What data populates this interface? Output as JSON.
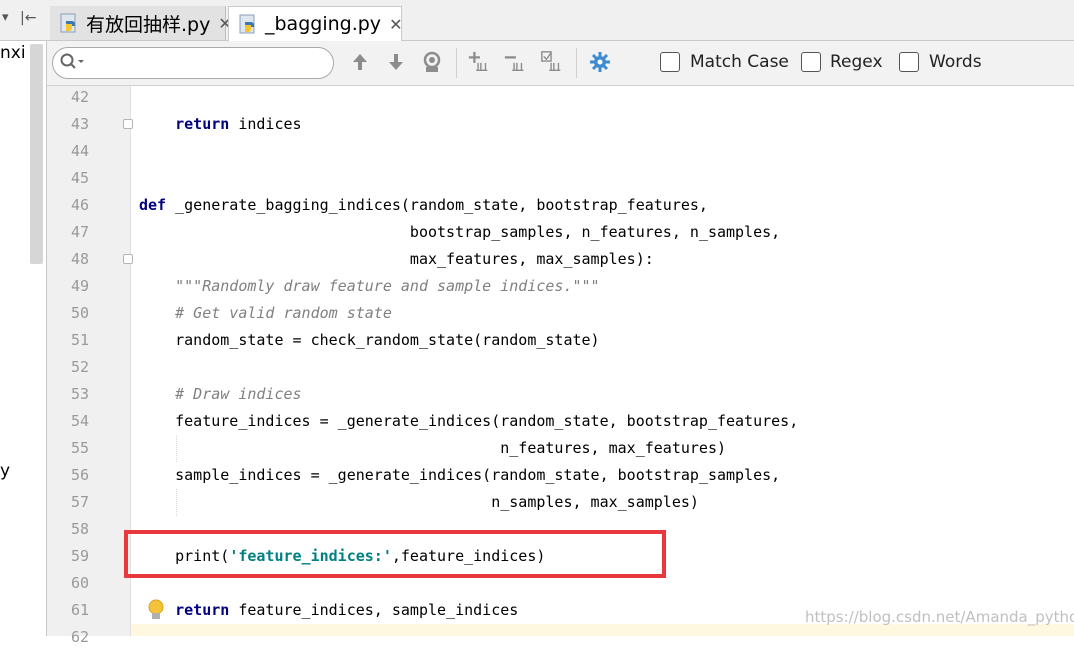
{
  "tabs": {
    "inactive": {
      "label": "有放回抽样.py",
      "close": "✕"
    },
    "active": {
      "label": "_bagging.py",
      "close": "✕"
    }
  },
  "project_strip": {
    "fragment_top": "nxi",
    "fragment_mid": "y",
    "top_arrow": "▾",
    "top_pin": "|←"
  },
  "search": {
    "placeholder": "",
    "options": [
      {
        "label": "Match Case",
        "checked": false
      },
      {
        "label": "Regex",
        "checked": false
      },
      {
        "label": "Words",
        "checked": false
      }
    ]
  },
  "toolbar_icons": [
    "arrow-up-icon",
    "arrow-down-icon",
    "find-all-icon",
    "add-occurrence-icon",
    "remove-occurrence-icon",
    "select-all-occurrences-icon",
    "settings-gear-icon"
  ],
  "editor": {
    "lines": [
      {
        "n": "42",
        "parts": []
      },
      {
        "n": "43",
        "parts": [
          {
            "t": "    "
          },
          {
            "t": "return",
            "c": "kw"
          },
          {
            "t": " indices"
          }
        ]
      },
      {
        "n": "44",
        "parts": []
      },
      {
        "n": "45",
        "parts": []
      },
      {
        "n": "46",
        "parts": [
          {
            "t": "def",
            "c": "kw"
          },
          {
            "t": " _generate_bagging_indices(random_state, bootstrap_features,"
          }
        ]
      },
      {
        "n": "47",
        "parts": [
          {
            "t": "                              bootstrap_samples, n_features, n_samples,"
          }
        ]
      },
      {
        "n": "48",
        "parts": [
          {
            "t": "                              max_features, max_samples):"
          }
        ]
      },
      {
        "n": "49",
        "parts": [
          {
            "t": "    "
          },
          {
            "t": "\"\"\"Randomly draw feature and sample indices.\"\"\"",
            "c": "cm"
          }
        ]
      },
      {
        "n": "50",
        "parts": [
          {
            "t": "    "
          },
          {
            "t": "# Get valid random state",
            "c": "cm"
          }
        ]
      },
      {
        "n": "51",
        "parts": [
          {
            "t": "    random_state = check_random_state(random_state)"
          }
        ]
      },
      {
        "n": "52",
        "parts": []
      },
      {
        "n": "53",
        "parts": [
          {
            "t": "    "
          },
          {
            "t": "# Draw indices",
            "c": "cm"
          }
        ]
      },
      {
        "n": "54",
        "parts": [
          {
            "t": "    feature_indices = _generate_indices(random_state, bootstrap_features,"
          }
        ]
      },
      {
        "n": "55",
        "parts": [
          {
            "t": "                                        n_features, max_features)"
          }
        ]
      },
      {
        "n": "56",
        "parts": [
          {
            "t": "    sample_indices = _generate_indices(random_state, bootstrap_samples,"
          }
        ]
      },
      {
        "n": "57",
        "parts": [
          {
            "t": "                                       n_samples, max_samples)"
          }
        ]
      },
      {
        "n": "58",
        "parts": []
      },
      {
        "n": "59",
        "parts": [
          {
            "t": "    print("
          },
          {
            "t": "'feature_indices:'",
            "c": "st"
          },
          {
            "t": ",feature_indices)"
          }
        ]
      },
      {
        "n": "60",
        "parts": []
      },
      {
        "n": "61",
        "parts": [
          {
            "t": "    "
          },
          {
            "t": "return",
            "c": "kw"
          },
          {
            "t": " feature_indices, sample_indices"
          }
        ]
      },
      {
        "n": "62",
        "parts": []
      }
    ]
  },
  "watermark": "https://blog.csdn.net/Amanda_python",
  "colors": {
    "highlight_box": "#e8383d",
    "keyword": "#000080",
    "comment": "#808080",
    "string": "#008080"
  }
}
